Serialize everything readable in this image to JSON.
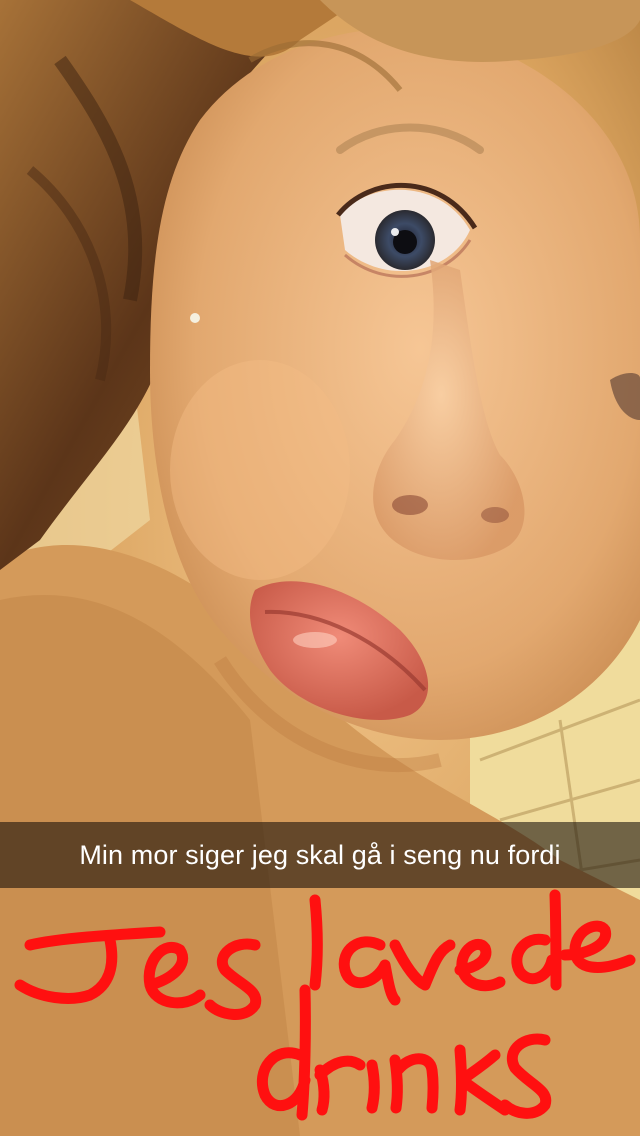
{
  "caption": {
    "text": "Min mor siger jeg skal gå i seng nu fordi"
  },
  "drawing": {
    "handwritten_text": "Jeg lavede drinks",
    "stroke_color": "#ff1010"
  },
  "colors": {
    "skin": "#e8b27a",
    "hair": "#6b4020",
    "tile": "#f1dc9a"
  }
}
